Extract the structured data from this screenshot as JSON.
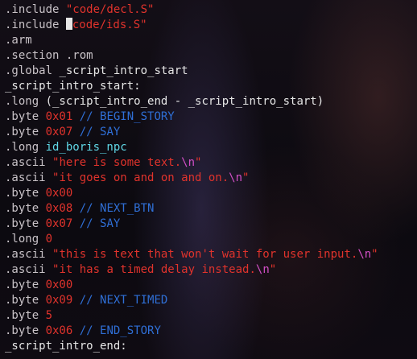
{
  "lines": [
    {
      "parts": [
        {
          "c": "dir",
          "t": ".include "
        },
        {
          "c": "str",
          "t": "\"code/decl.S\""
        }
      ]
    },
    {
      "parts": [
        {
          "c": "dir",
          "t": ".include "
        },
        {
          "c": "cursor",
          "t": ""
        },
        {
          "c": "str",
          "t": "code/ids.S\""
        }
      ]
    },
    {
      "parts": [
        {
          "c": "dir",
          "t": ".arm"
        }
      ]
    },
    {
      "parts": [
        {
          "c": "dir",
          "t": ".section .rom"
        }
      ]
    },
    {
      "parts": [
        {
          "c": "dir",
          "t": ".global "
        },
        {
          "c": "plain",
          "t": "_script_intro_start"
        }
      ]
    },
    {
      "parts": [
        {
          "c": "plain",
          "t": "_script_intro_start:"
        }
      ]
    },
    {
      "parts": [
        {
          "c": "dir",
          "t": ".long "
        },
        {
          "c": "plain",
          "t": "(_script_intro_end - _script_intro_start)"
        }
      ]
    },
    {
      "parts": [
        {
          "c": "dir",
          "t": ".byte "
        },
        {
          "c": "num",
          "t": "0x01"
        },
        {
          "c": "cmt",
          "t": " // BEGIN_STORY"
        }
      ]
    },
    {
      "parts": [
        {
          "c": "dir",
          "t": ".byte "
        },
        {
          "c": "num",
          "t": "0x07"
        },
        {
          "c": "cmt",
          "t": " // SAY"
        }
      ]
    },
    {
      "parts": [
        {
          "c": "dir",
          "t": ".long "
        },
        {
          "c": "sym",
          "t": "id_boris_npc"
        }
      ]
    },
    {
      "parts": [
        {
          "c": "dir",
          "t": ".ascii "
        },
        {
          "c": "str",
          "t": "\"here is some text."
        },
        {
          "c": "esc",
          "t": "\\n"
        },
        {
          "c": "str",
          "t": "\""
        }
      ]
    },
    {
      "parts": [
        {
          "c": "dir",
          "t": ".ascii "
        },
        {
          "c": "str",
          "t": "\"it goes on and on and on."
        },
        {
          "c": "esc",
          "t": "\\n"
        },
        {
          "c": "str",
          "t": "\""
        }
      ]
    },
    {
      "parts": [
        {
          "c": "dir",
          "t": ".byte "
        },
        {
          "c": "num",
          "t": "0x00"
        }
      ]
    },
    {
      "parts": [
        {
          "c": "dir",
          "t": ".byte "
        },
        {
          "c": "num",
          "t": "0x08"
        },
        {
          "c": "cmt",
          "t": " // NEXT_BTN"
        }
      ]
    },
    {
      "parts": [
        {
          "c": "dir",
          "t": ".byte "
        },
        {
          "c": "num",
          "t": "0x07"
        },
        {
          "c": "cmt",
          "t": " // SAY"
        }
      ]
    },
    {
      "parts": [
        {
          "c": "dir",
          "t": ".long "
        },
        {
          "c": "num",
          "t": "0"
        }
      ]
    },
    {
      "parts": [
        {
          "c": "dir",
          "t": ".ascii "
        },
        {
          "c": "str",
          "t": "\"this is text that won't wait for user input."
        },
        {
          "c": "esc",
          "t": "\\n"
        },
        {
          "c": "str",
          "t": "\""
        }
      ]
    },
    {
      "parts": [
        {
          "c": "dir",
          "t": ".ascii "
        },
        {
          "c": "str",
          "t": "\"it has a timed delay instead."
        },
        {
          "c": "esc",
          "t": "\\n"
        },
        {
          "c": "str",
          "t": "\""
        }
      ]
    },
    {
      "parts": [
        {
          "c": "dir",
          "t": ".byte "
        },
        {
          "c": "num",
          "t": "0x00"
        }
      ]
    },
    {
      "parts": [
        {
          "c": "dir",
          "t": ".byte "
        },
        {
          "c": "num",
          "t": "0x09"
        },
        {
          "c": "cmt",
          "t": " // NEXT_TIMED"
        }
      ]
    },
    {
      "parts": [
        {
          "c": "dir",
          "t": ".byte "
        },
        {
          "c": "num",
          "t": "5"
        }
      ]
    },
    {
      "parts": [
        {
          "c": "dir",
          "t": ".byte "
        },
        {
          "c": "num",
          "t": "0x06"
        },
        {
          "c": "cmt",
          "t": " // END_STORY"
        }
      ]
    },
    {
      "parts": [
        {
          "c": "plain",
          "t": "_script_intro_end:"
        }
      ]
    }
  ]
}
